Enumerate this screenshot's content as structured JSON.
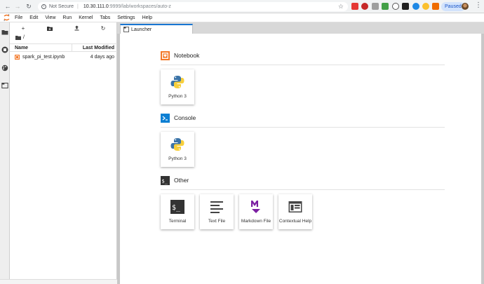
{
  "browser": {
    "security_label": "Not Secure",
    "url_host": "10.30.111.0",
    "url_rest": ":9999/lab/workspaces/auto-z",
    "paused_label": "Paused"
  },
  "menu": [
    "File",
    "Edit",
    "View",
    "Run",
    "Kernel",
    "Tabs",
    "Settings",
    "Help"
  ],
  "filebrowser": {
    "path": "/",
    "col_name": "Name",
    "col_modified": "Last Modified",
    "files": [
      {
        "name": "spark_pi_test.ipynb",
        "modified": "4 days ago"
      }
    ]
  },
  "tabs": [
    {
      "label": "Launcher"
    }
  ],
  "launcher": {
    "sections": [
      {
        "title": "Notebook",
        "cards": [
          {
            "label": "Python 3",
            "icon": "python-logo-icon"
          }
        ]
      },
      {
        "title": "Console",
        "cards": [
          {
            "label": "Python 3",
            "icon": "python-logo-icon"
          }
        ]
      },
      {
        "title": "Other",
        "cards": [
          {
            "label": "Terminal",
            "icon": "terminal-icon"
          },
          {
            "label": "Text File",
            "icon": "text-file-icon"
          },
          {
            "label": "Markdown File",
            "icon": "markdown-icon"
          },
          {
            "label": "Contextual Help",
            "icon": "contextual-help-icon"
          }
        ]
      }
    ]
  },
  "colors": {
    "jupyter_orange": "#f37726",
    "accent_blue": "#1976d2",
    "markdown_purple": "#7b1fa2",
    "console_blue": "#0d7fd3"
  }
}
